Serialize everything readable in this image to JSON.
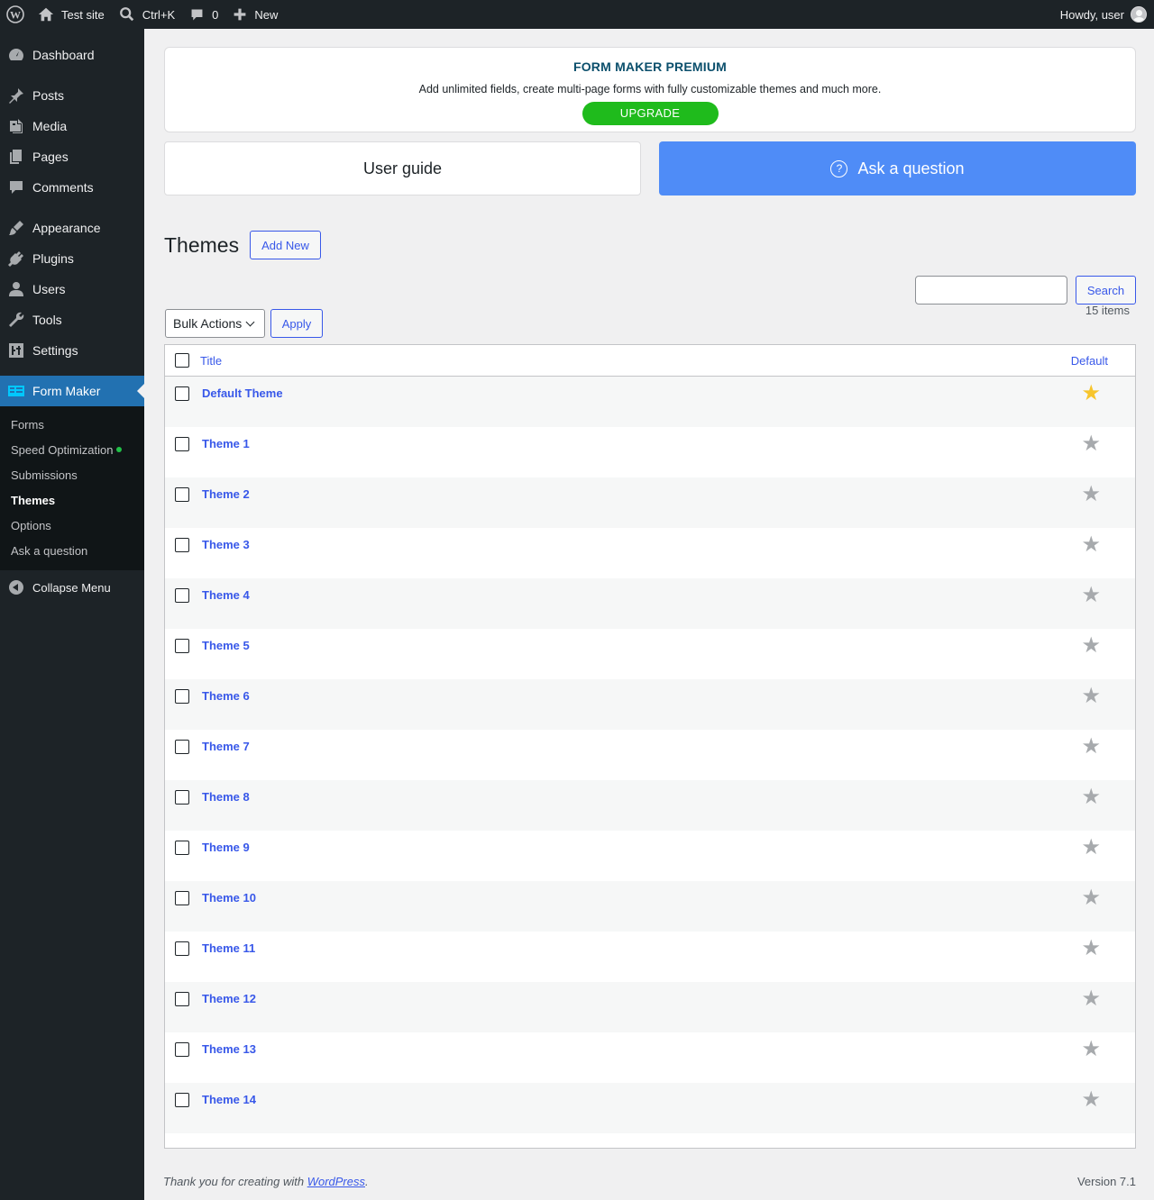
{
  "adminbar": {
    "site_name": "Test site",
    "search_shortcut": "Ctrl+K",
    "comments_count": "0",
    "new_label": "New",
    "greeting": "Howdy, user"
  },
  "sidebar": {
    "items": [
      {
        "label": "Dashboard",
        "icon": "dashboard-icon"
      },
      {
        "label": "Posts",
        "icon": "pin-icon"
      },
      {
        "label": "Media",
        "icon": "media-icon"
      },
      {
        "label": "Pages",
        "icon": "pages-icon"
      },
      {
        "label": "Comments",
        "icon": "comment-icon"
      },
      {
        "label": "Appearance",
        "icon": "brush-icon"
      },
      {
        "label": "Plugins",
        "icon": "plug-icon"
      },
      {
        "label": "Users",
        "icon": "user-icon"
      },
      {
        "label": "Tools",
        "icon": "wrench-icon"
      },
      {
        "label": "Settings",
        "icon": "sliders-icon"
      },
      {
        "label": "Form Maker",
        "icon": "form-maker-icon"
      }
    ],
    "submenu": [
      "Forms",
      "Speed Optimization",
      "Submissions",
      "Themes",
      "Options",
      "Ask a question"
    ],
    "collapse_label": "Collapse Menu"
  },
  "promo": {
    "title": "FORM MAKER PREMIUM",
    "text": "Add unlimited fields, create multi-page forms with fully customizable themes and much more.",
    "button": "UPGRADE"
  },
  "help": {
    "guide": "User guide",
    "ask": "Ask a question"
  },
  "page": {
    "title": "Themes",
    "add_new": "Add New",
    "search_button": "Search",
    "search_value": "",
    "bulk_actions": "Bulk Actions",
    "apply": "Apply",
    "count": "15 items"
  },
  "table": {
    "headers": {
      "title": "Title",
      "default": "Default"
    },
    "rows": [
      {
        "title": "Default Theme",
        "default": true
      },
      {
        "title": "Theme 1",
        "default": false
      },
      {
        "title": "Theme 2",
        "default": false
      },
      {
        "title": "Theme 3",
        "default": false
      },
      {
        "title": "Theme 4",
        "default": false
      },
      {
        "title": "Theme 5",
        "default": false
      },
      {
        "title": "Theme 6",
        "default": false
      },
      {
        "title": "Theme 7",
        "default": false
      },
      {
        "title": "Theme 8",
        "default": false
      },
      {
        "title": "Theme 9",
        "default": false
      },
      {
        "title": "Theme 10",
        "default": false
      },
      {
        "title": "Theme 11",
        "default": false
      },
      {
        "title": "Theme 12",
        "default": false
      },
      {
        "title": "Theme 13",
        "default": false
      },
      {
        "title": "Theme 14",
        "default": false
      }
    ]
  },
  "footer": {
    "thanks": "Thank you for creating with",
    "wordpress": "WordPress",
    "period": ".",
    "version": "Version 7.1"
  },
  "colors": {
    "accent": "#3858e9",
    "upgrade": "#1fbb1c",
    "ask_button": "#4f8cf7",
    "star_default": "#f7c52c",
    "star_inactive": "#a7aaad"
  }
}
